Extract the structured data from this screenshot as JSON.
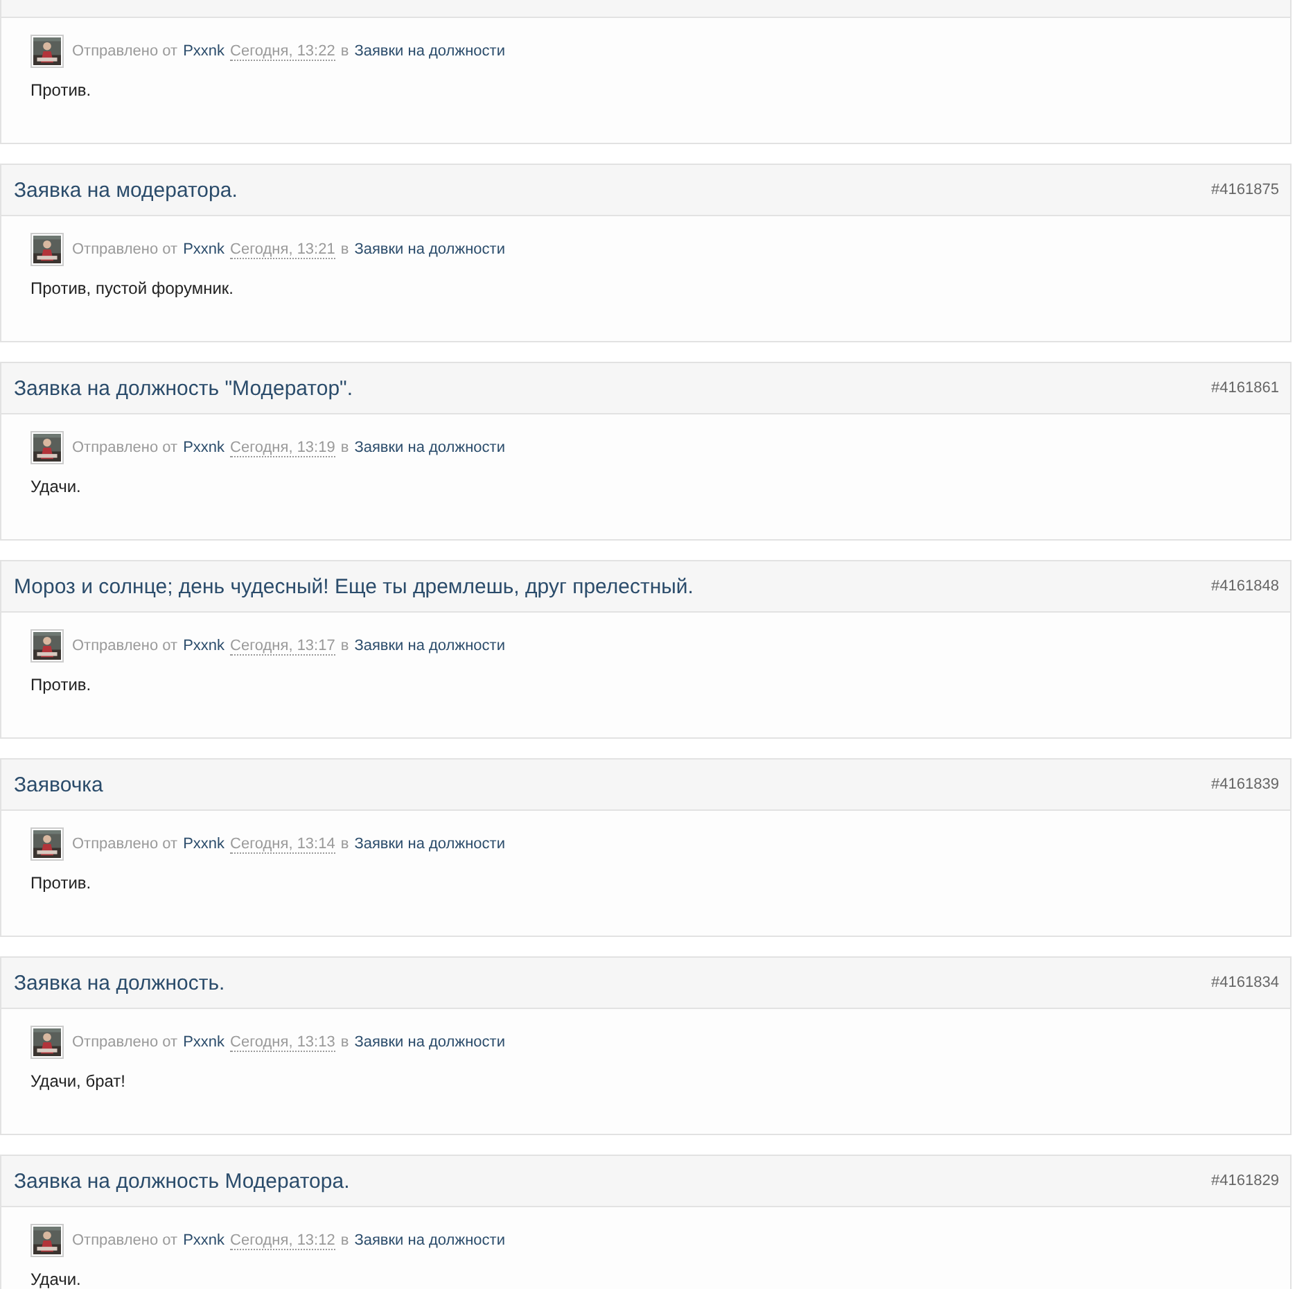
{
  "posts": [
    {
      "posted_label": "Отправлено от",
      "author": "Pxxnk",
      "date": "Сегодня, 13:22",
      "in_label": "в",
      "forum": "Заявки на должности",
      "body": "Против."
    },
    {
      "title": "Заявка на модератора.",
      "number": "#4161875",
      "posted_label": "Отправлено от",
      "author": "Pxxnk",
      "date": "Сегодня, 13:21",
      "in_label": "в",
      "forum": "Заявки на должности",
      "body": "Против, пустой форумник."
    },
    {
      "title": "Заявка на должность \"Модератор\".",
      "number": "#4161861",
      "posted_label": "Отправлено от",
      "author": "Pxxnk",
      "date": "Сегодня, 13:19",
      "in_label": "в",
      "forum": "Заявки на должности",
      "body": "Удачи."
    },
    {
      "title": "Мороз и солнце; день чудесный! Еще ты дремлешь, друг прелестный.",
      "number": "#4161848",
      "posted_label": "Отправлено от",
      "author": "Pxxnk",
      "date": "Сегодня, 13:17",
      "in_label": "в",
      "forum": "Заявки на должности",
      "body": "Против."
    },
    {
      "title": "Заявочка",
      "number": "#4161839",
      "posted_label": "Отправлено от",
      "author": "Pxxnk",
      "date": "Сегодня, 13:14",
      "in_label": "в",
      "forum": "Заявки на должности",
      "body": "Против."
    },
    {
      "title": "Заявка на должность.",
      "number": "#4161834",
      "posted_label": "Отправлено от",
      "author": "Pxxnk",
      "date": "Сегодня, 13:13",
      "in_label": "в",
      "forum": "Заявки на должности",
      "body": "Удачи, брат!"
    },
    {
      "title": "Заявка на должность Модератора.",
      "number": "#4161829",
      "posted_label": "Отправлено от",
      "author": "Pxxnk",
      "date": "Сегодня, 13:12",
      "in_label": "в",
      "forum": "Заявки на должности",
      "body": "Удачи."
    }
  ]
}
